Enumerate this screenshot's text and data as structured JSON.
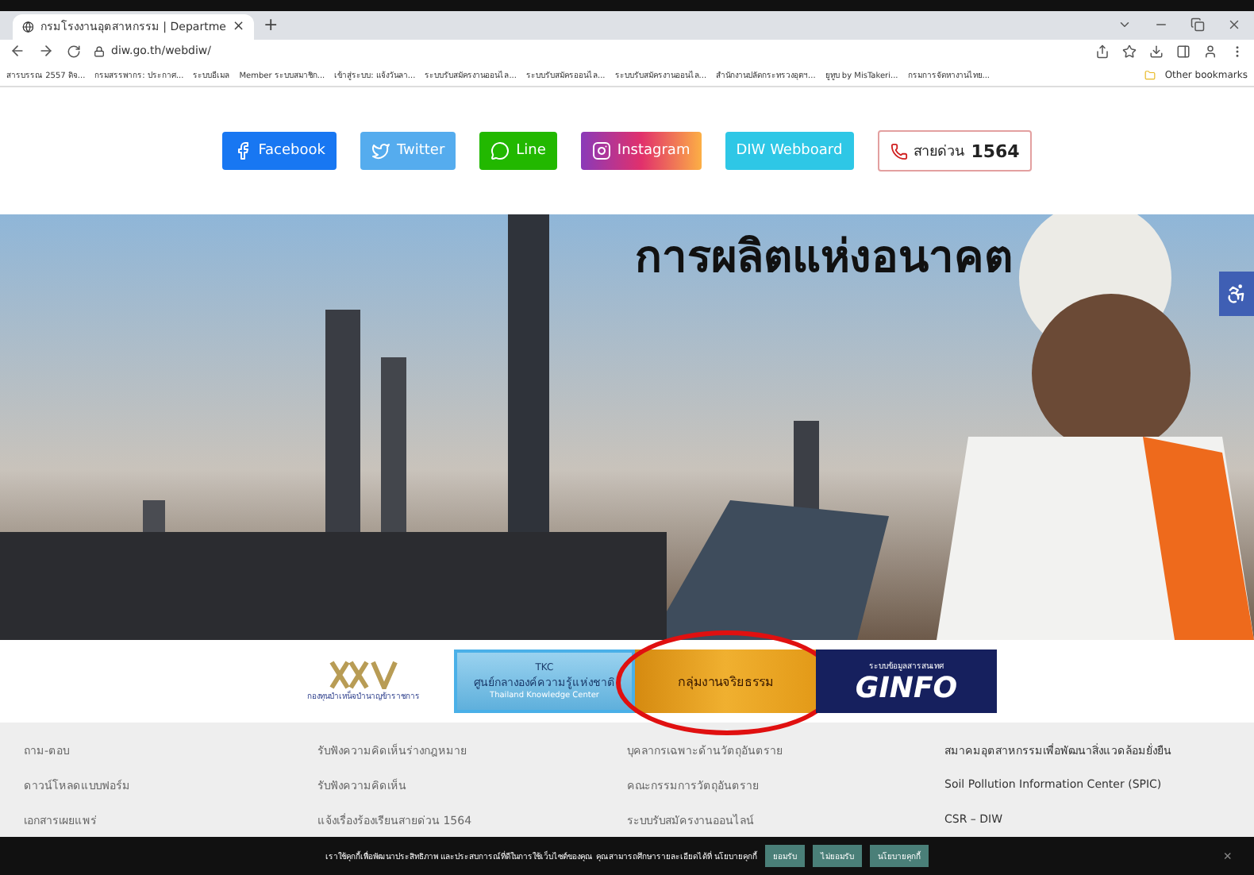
{
  "browser": {
    "tab": {
      "title": "กรมโรงงานอุตสาหกรรม | Departme",
      "close": "×",
      "selected": true
    },
    "new_tab": "+",
    "url": "diw.go.th/webdiw/",
    "bookmarks": [
      "สารบรรณ 2557 ดิจ...",
      "กรมสรรพากร: ประกาศ...",
      "ระบบอีเมล",
      "Member ระบบสมาชิก...",
      "เข้าสู่ระบบ: แจ้งวันลา...",
      "ระบบรับสมัครงานออนไล...",
      "ระบบรับสมัครออนไล...",
      "ระบบรับสมัครงานออนไล...",
      "สำนักงานปลัดกระทรวงอุตฯ...",
      "ยูทูบ by MisTakeri...",
      "กรมการจัดหางานไทย..."
    ],
    "other_bookmarks": "Other bookmarks"
  },
  "social": [
    {
      "kind": "facebook",
      "label": "Facebook"
    },
    {
      "kind": "twitter",
      "label": "Twitter"
    },
    {
      "kind": "line",
      "label": "Line"
    },
    {
      "kind": "instagram",
      "label": "Instagram"
    },
    {
      "kind": "webboard",
      "label": "DIW Webboard"
    },
    {
      "kind": "hotline",
      "label": "สายด่วน",
      "number": "1564"
    }
  ],
  "hero": {
    "headline": "การผลิตแห่งอนาคต",
    "kind": "picture"
  },
  "banners": [
    {
      "kind": "gpf",
      "caption": "กองทุนบำเหน็จบำนาญข้าราชการ",
      "highlighted": false
    },
    {
      "kind": "tkc",
      "badge": "TKC",
      "title": "ศูนย์กลางองค์ความรู้แห่งชาติ",
      "subtitle": "Thailand Knowledge Center",
      "highlighted": false
    },
    {
      "kind": "ethics",
      "title": "กลุ่มงานจริยธรรม",
      "highlighted": true
    },
    {
      "kind": "ginfo",
      "top": "ระบบข้อมูลสารสนเทศ",
      "logo": "GINFO",
      "highlighted": false
    }
  ],
  "footer_links": [
    [
      "ถาม-ตอบ",
      "รับฟังความคิดเห็นร่างกฎหมาย",
      "บุคลากรเฉพาะด้านวัตถุอันตราย",
      "สมาคมอุตสาหกรรมเพื่อพัฒนาสิ่งแวดล้อมยั่งยืน"
    ],
    [
      "ดาวน์โหลดแบบฟอร์ม",
      "รับฟังความคิดเห็น",
      "คณะกรรมการวัตถุอันตราย",
      "Soil Pollution Information Center (SPIC)"
    ],
    [
      "เอกสารเผยแพร่",
      "แจ้งเรื่องร้องเรียนสายด่วน 1564",
      "ระบบรับสมัครงานออนไลน์",
      "CSR – DIW"
    ]
  ],
  "cookie": {
    "text": "เราใช้คุกกี้เพื่อพัฒนาประสิทธิภาพ และประสบการณ์ที่ดีในการใช้เว็บไซต์ของคุณ คุณสามารถศึกษารายละเอียดได้ที่ นโยบายคุกกี้",
    "buttons": [
      "ยอมรับ",
      "ไม่ยอมรับ",
      "นโยบายคุกกี้"
    ],
    "close": "×"
  }
}
